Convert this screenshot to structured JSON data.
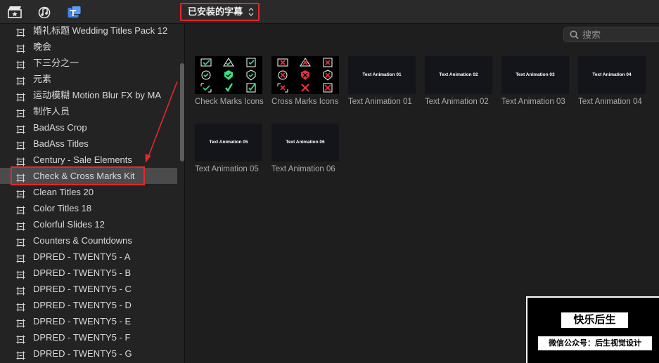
{
  "toolbar": {
    "icons": [
      "clapper-star-icon",
      "music-note-icon",
      "titles-icon"
    ],
    "library_select": {
      "value": "已安装的字幕"
    }
  },
  "sidebar": {
    "selected_index": 9,
    "items": [
      {
        "label": "婚礼标题 Wedding Titles Pack 12"
      },
      {
        "label": "晚会"
      },
      {
        "label": "下三分之一"
      },
      {
        "label": "元素"
      },
      {
        "label": "运动模糊 Motion Blur FX by MA"
      },
      {
        "label": "制作人员"
      },
      {
        "label": "BadAss Crop"
      },
      {
        "label": "BadAss Titles"
      },
      {
        "label": "Century - Sale Elements"
      },
      {
        "label": "Check & Cross Marks Kit"
      },
      {
        "label": "Clean Titles 20"
      },
      {
        "label": "Color Titles 18"
      },
      {
        "label": "Colorful Slides 12"
      },
      {
        "label": "Counters & Countdowns"
      },
      {
        "label": "DPRED - TWENTY5 - A"
      },
      {
        "label": "DPRED - TWENTY5 - B"
      },
      {
        "label": "DPRED - TWENTY5 - C"
      },
      {
        "label": "DPRED - TWENTY5 - D"
      },
      {
        "label": "DPRED - TWENTY5 - E"
      },
      {
        "label": "DPRED - TWENTY5 - F"
      },
      {
        "label": "DPRED - TWENTY5 - G"
      }
    ]
  },
  "search": {
    "placeholder": "搜索",
    "value": ""
  },
  "browser": {
    "tiles": [
      {
        "label": "Check Marks Icons",
        "thumb_text": "",
        "kind": "check"
      },
      {
        "label": "Cross Marks Icons",
        "thumb_text": "",
        "kind": "cross"
      },
      {
        "label": "Text Animation 01",
        "thumb_text": "Text Animation 01",
        "kind": "text"
      },
      {
        "label": "Text Animation 02",
        "thumb_text": "Text Animation 02",
        "kind": "text"
      },
      {
        "label": "Text Animation 03",
        "thumb_text": "Text Animation 03",
        "kind": "text"
      },
      {
        "label": "Text Animation 04",
        "thumb_text": "Text Animation 04",
        "kind": "text"
      },
      {
        "label": "Text Animation 05",
        "thumb_text": "Text Animation 05",
        "kind": "text"
      },
      {
        "label": "Text Animation 06",
        "thumb_text": "Text Animation 06",
        "kind": "text"
      }
    ]
  },
  "watermark": {
    "title": "快乐后生",
    "subtitle": "微信公众号：后生视觉设计"
  },
  "colors": {
    "accent_red": "#e02a2a",
    "check_green": "#3ddc84",
    "cross_red": "#e8323a",
    "selected_row": "#4b4b4b"
  }
}
